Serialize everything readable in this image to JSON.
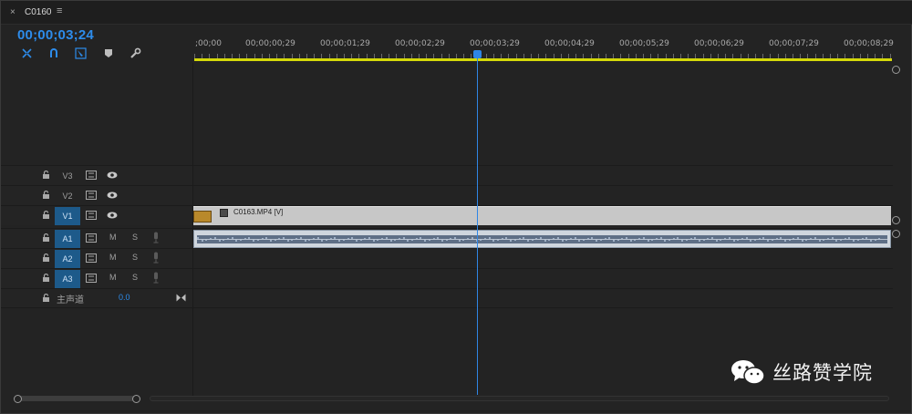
{
  "tab": {
    "close_glyph": "×",
    "title": "C0160",
    "menu_glyph": "≡"
  },
  "timecode": "00;00;03;24",
  "toolbar": {
    "icons": [
      "insert-nest-icon",
      "snap-magnet-icon",
      "linked-selection-icon",
      "add-marker-icon",
      "settings-wrench-icon"
    ]
  },
  "ruler": {
    "labels": [
      ";00;00",
      "00;00;00;29",
      "00;00;01;29",
      "00;00;02;29",
      "00;00;03;29",
      "00;00;04;29",
      "00;00;05;29",
      "00;00;06;29",
      "00;00;07;29",
      "00;00;08;29"
    ]
  },
  "tracks": {
    "v3": {
      "name": "V3"
    },
    "v2": {
      "name": "V2"
    },
    "v1": {
      "name": "V1"
    },
    "a1": {
      "name": "A1",
      "mute": "M",
      "solo": "S"
    },
    "a2": {
      "name": "A2",
      "mute": "M",
      "solo": "S"
    },
    "a3": {
      "name": "A3",
      "mute": "M",
      "solo": "S"
    },
    "master": {
      "name": "主声道",
      "value": "0.0"
    }
  },
  "clips": {
    "video_name": "C0163.MP4 [V]"
  },
  "watermark": {
    "text": "丝路赞学院"
  },
  "colors": {
    "accent": "#2d8ceb",
    "workbar": "#d4d80a",
    "track_active": "#1d5a8a"
  }
}
